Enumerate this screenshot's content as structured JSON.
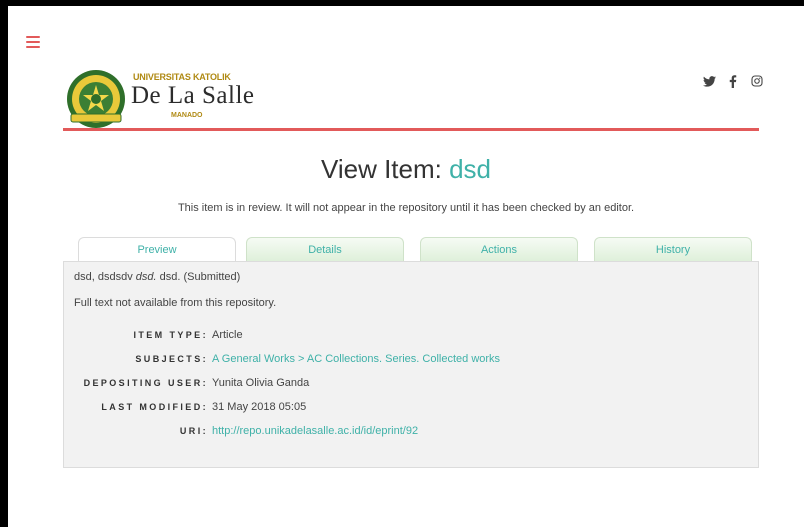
{
  "header": {
    "logo": {
      "top_text": "UNIVERSITAS KATOLIK",
      "main_text": "De La Salle",
      "bottom_text": "MANADO",
      "seal_text": "DE LA SALLE"
    },
    "social_icons": [
      "twitter-icon",
      "facebook-icon",
      "instagram-icon"
    ],
    "colors": {
      "accent": "#e25a5a",
      "link": "#3fb1a8",
      "logo_gold": "#b08a14"
    }
  },
  "page": {
    "title_prefix": "View Item: ",
    "title_item": "dsd",
    "notice": "This item is in review. It will not appear in the repository until it has been checked by an editor."
  },
  "tabs": [
    {
      "label": "Preview",
      "active": true
    },
    {
      "label": "Details",
      "active": false
    },
    {
      "label": "Actions",
      "active": false
    },
    {
      "label": "History",
      "active": false
    }
  ],
  "panel": {
    "citation_authors": "dsd, dsdsdv",
    "citation_title": "dsd.",
    "citation_rest": "dsd. (Submitted)",
    "fulltext_note": "Full text not available from this repository.",
    "fields": [
      {
        "label": "ITEM TYPE:",
        "value": "Article",
        "link": false
      },
      {
        "label": "SUBJECTS:",
        "value": "A General Works > AC Collections. Series. Collected works",
        "link": true
      },
      {
        "label": "DEPOSITING USER:",
        "value": "Yunita Olivia Ganda",
        "link": false
      },
      {
        "label": "LAST MODIFIED:",
        "value": "31 May 2018 05:05",
        "link": false
      },
      {
        "label": "URI:",
        "value": "http://repo.unikadelasalle.ac.id/id/eprint/92",
        "link": true
      }
    ]
  }
}
